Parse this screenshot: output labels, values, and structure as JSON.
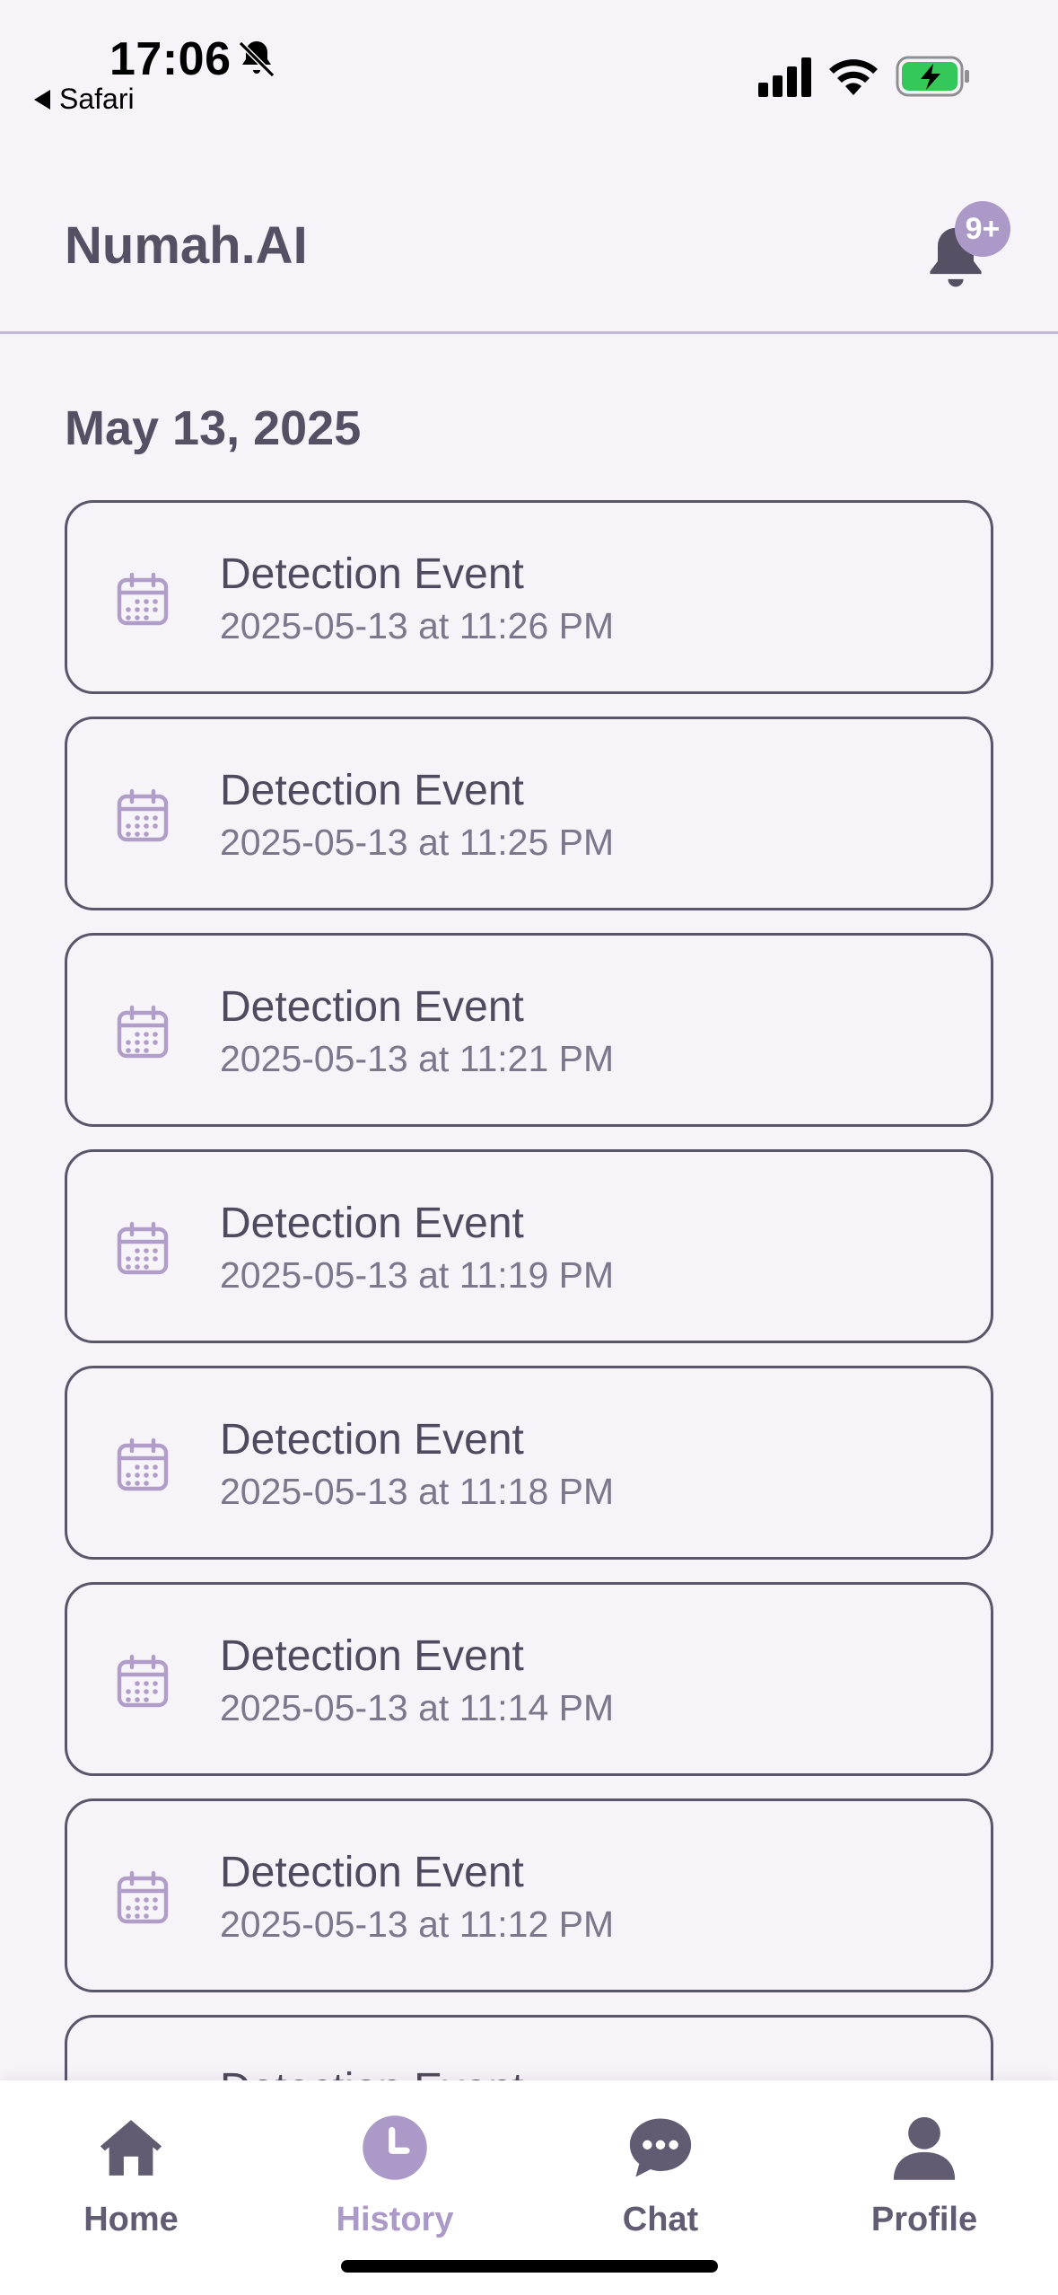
{
  "status_bar": {
    "time": "17:06",
    "back_app": "Safari",
    "battery_state": "charging"
  },
  "header": {
    "title": "Numah.AI",
    "notification_badge": "9+"
  },
  "section": {
    "date": "May 13, 2025"
  },
  "events": [
    {
      "title": "Detection Event",
      "timestamp": "2025-05-13 at 11:26 PM"
    },
    {
      "title": "Detection Event",
      "timestamp": "2025-05-13 at 11:25 PM"
    },
    {
      "title": "Detection Event",
      "timestamp": "2025-05-13 at 11:21 PM"
    },
    {
      "title": "Detection Event",
      "timestamp": "2025-05-13 at 11:19 PM"
    },
    {
      "title": "Detection Event",
      "timestamp": "2025-05-13 at 11:18 PM"
    },
    {
      "title": "Detection Event",
      "timestamp": "2025-05-13 at 11:14 PM"
    },
    {
      "title": "Detection Event",
      "timestamp": "2025-05-13 at 11:12 PM"
    },
    {
      "title": "Detection Event",
      "timestamp": ""
    }
  ],
  "bottom_nav": [
    {
      "label": "Home",
      "icon": "home-icon",
      "active": false
    },
    {
      "label": "History",
      "icon": "clock-icon",
      "active": true
    },
    {
      "label": "Chat",
      "icon": "chat-bubble-icon",
      "active": false
    },
    {
      "label": "Profile",
      "icon": "person-icon",
      "active": false
    }
  ],
  "colors": {
    "accent": "#ab9ac8",
    "text": "#4f4a5e",
    "background": "#f6f4f9",
    "card_border": "#5a566a"
  }
}
